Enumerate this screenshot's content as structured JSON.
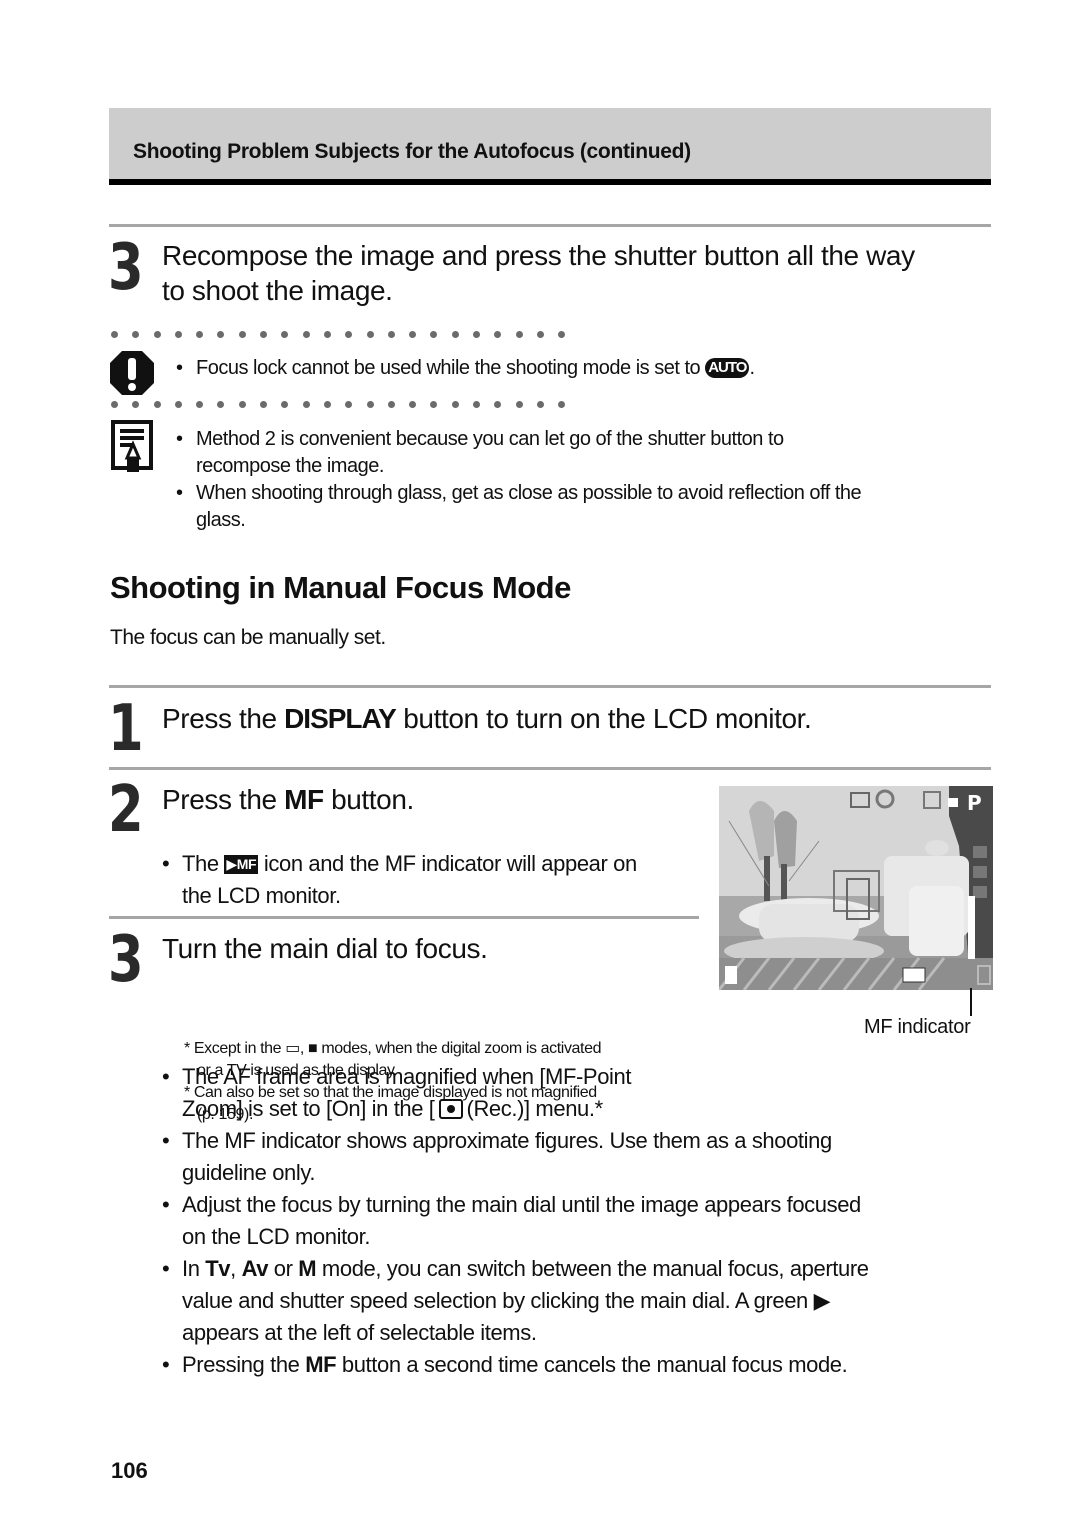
{
  "header": {
    "title": "Shooting Problem Subjects for the Autofocus (continued)"
  },
  "prev_step": {
    "number": "3",
    "title_line1": "Recompose the image and press the shutter button all the way",
    "title_line2": "to shoot the image."
  },
  "caution": {
    "icon": "caution-icon",
    "text": "Focus lock cannot be used while the shooting mode is set to",
    "badge": "AUTO",
    "suffix": "."
  },
  "note": {
    "icon": "memo-icon",
    "items": [
      {
        "line1": "Method 2 is convenient because you can let go of the shutter button to",
        "line2": "recompose the image."
      },
      {
        "line1": "When shooting through glass, get as close as possible to avoid reflection off the",
        "line2": "glass."
      }
    ]
  },
  "section": {
    "title": "Shooting in Manual Focus Mode",
    "intro": "The focus can be manually set."
  },
  "step1": {
    "number": "1",
    "pre": "Press the ",
    "bold": "DISPLAY",
    "post": " button to turn on the LCD monitor."
  },
  "step2": {
    "number": "2",
    "pre": "Press the ",
    "bold": "MF",
    "post": " button.",
    "bullet_pre": "The ",
    "bullet_icon": "▶MF",
    "bullet_post_line1": " icon and the MF indicator will appear on",
    "bullet_line2": "the LCD monitor."
  },
  "step3": {
    "number": "3",
    "title": "Turn the main dial to focus.",
    "bullet_line1": "The AF frame area is magnified when [MF-Point",
    "bullet_line2_pre": "Zoom] is set to [On] in the [",
    "bullet_line2_post": "(Rec.)] menu.*",
    "footnote1_line1": "* Except in the ▭, ■ modes, when the digital zoom is activated",
    "footnote1_line2": "or a TV is used as the display.",
    "footnote2_line1": "* Can also be set so that the image displayed is not magnified",
    "footnote2_line2": "(p. 159)."
  },
  "lcd": {
    "mode": "P",
    "indicator_label": "MF indicator"
  },
  "bullets": [
    {
      "line1": "The MF indicator shows approximate figures. Use them as a shooting",
      "line2": "guideline only."
    },
    {
      "line1": "Adjust the focus by turning the main dial until the image appears focused",
      "line2": "on the LCD monitor."
    }
  ],
  "mode_bullet": {
    "pre": "In ",
    "tv": "Tv",
    "comma": ", ",
    "av": "Av",
    "or": " or ",
    "m": "M",
    "post_line1": " mode, you can switch between the manual focus, aperture",
    "line2": "value and shutter speed selection by clicking the main dial. A green ▶",
    "line3": "appears at the left of selectable items."
  },
  "last_bullet": {
    "pre": "Pressing the ",
    "bold": "MF",
    "post": " button a second time cancels the manual focus mode."
  },
  "page_number": "106"
}
